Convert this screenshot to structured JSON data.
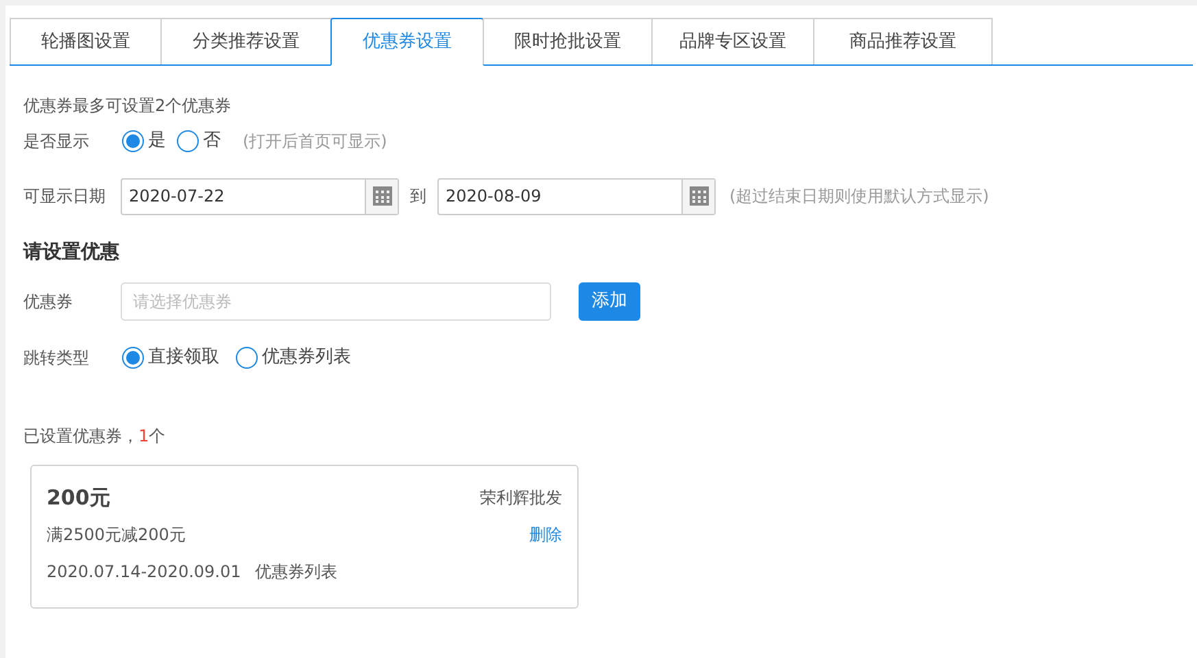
{
  "tabs": [
    {
      "label": "轮播图设置",
      "selected": false
    },
    {
      "label": "分类推荐设置",
      "selected": false
    },
    {
      "label": "优惠券设置",
      "selected": true
    },
    {
      "label": "限时抢批设置",
      "selected": false
    },
    {
      "label": "品牌专区设置",
      "selected": false
    },
    {
      "label": "商品推荐设置",
      "selected": false
    }
  ],
  "note": "优惠券最多可设置2个优惠券",
  "display": {
    "label": "是否显示",
    "options": [
      {
        "label": "是",
        "selected": true
      },
      {
        "label": "否",
        "selected": false
      }
    ],
    "hint": "(打开后首页可显示)"
  },
  "date_range": {
    "label": "可显示日期",
    "start": "2020-07-22",
    "separator": "到",
    "end": "2020-08-09",
    "hint": "(超过结束日期则使用默认方式显示)"
  },
  "section_title": "请设置优惠",
  "coupon": {
    "label": "优惠券",
    "placeholder": "请选择优惠券",
    "button": "添加"
  },
  "jump_type": {
    "label": "跳转类型",
    "options": [
      {
        "label": "直接领取",
        "selected": true
      },
      {
        "label": "优惠券列表",
        "selected": false
      }
    ]
  },
  "summary": {
    "prefix": "已设置优惠券，",
    "count": "1",
    "suffix": "个"
  },
  "coupons": [
    {
      "amount": "200元",
      "shop": "荣利辉批发",
      "rule": "满2500元减200元",
      "delete": "删除",
      "period": "2020.07.14-2020.09.01",
      "jump": "优惠券列表"
    }
  ]
}
